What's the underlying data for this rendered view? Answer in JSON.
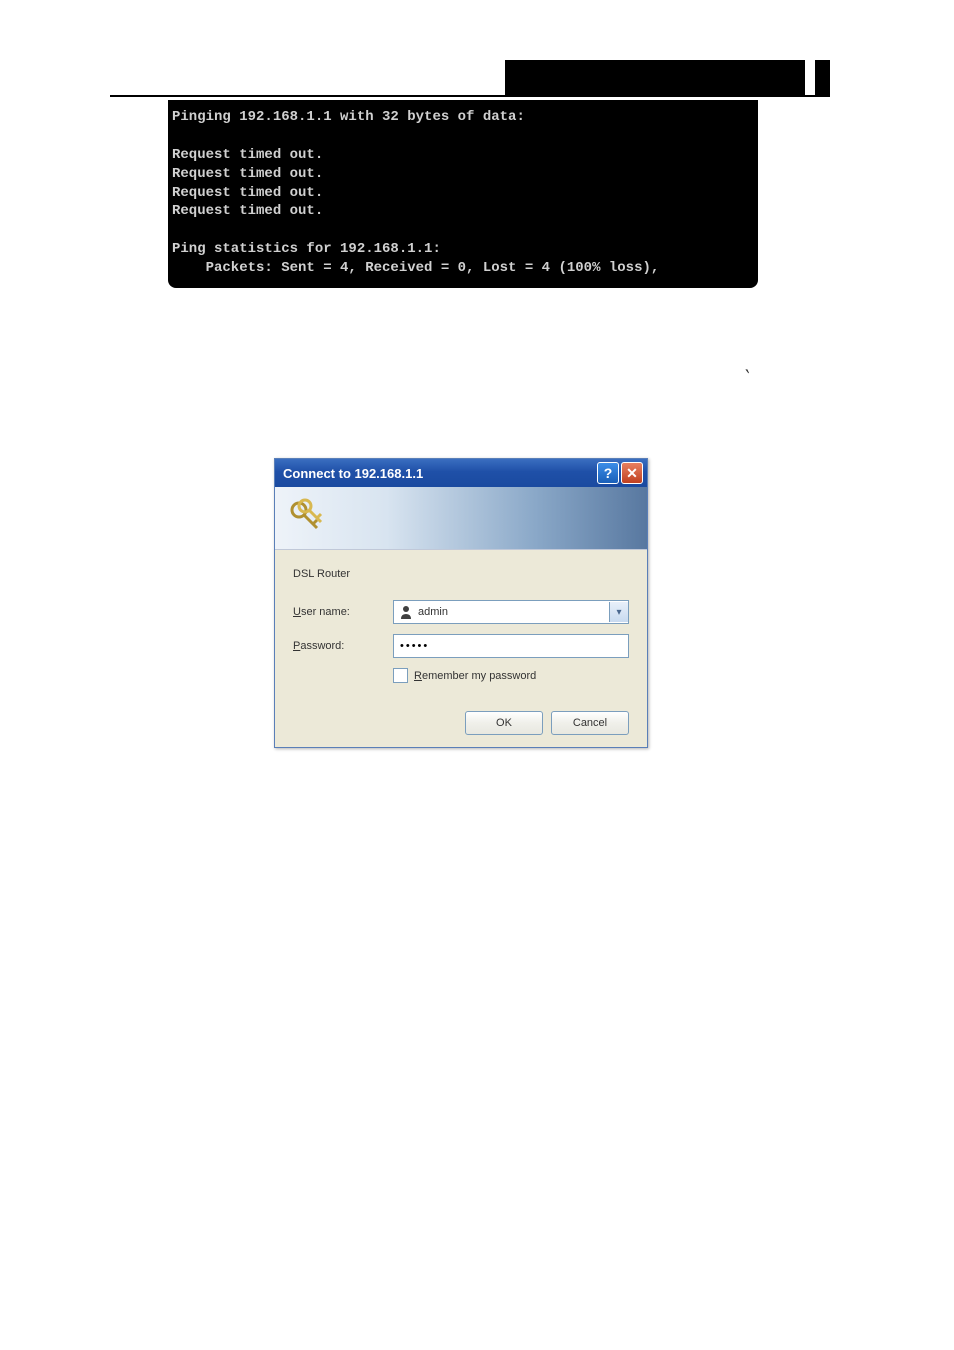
{
  "terminal": {
    "line1": "Pinging 192.168.1.1 with 32 bytes of data:",
    "line2": "Request timed out.",
    "line3": "Request timed out.",
    "line4": "Request timed out.",
    "line5": "Request timed out.",
    "line6": "Ping statistics for 192.168.1.1:",
    "line7": "    Packets: Sent = 4, Received = 0, Lost = 4 (100% loss),"
  },
  "dialog": {
    "title": "Connect to 192.168.1.1",
    "realm": "DSL Router",
    "username_label_prefix": "U",
    "username_label_rest": "ser name:",
    "username_value": "admin",
    "password_label_prefix": "P",
    "password_label_rest": "assword:",
    "password_value": "•••••",
    "remember_prefix": "R",
    "remember_rest": "emember my password",
    "ok_label": "OK",
    "cancel_label": "Cancel",
    "help_label": "?",
    "close_label": "✕"
  }
}
